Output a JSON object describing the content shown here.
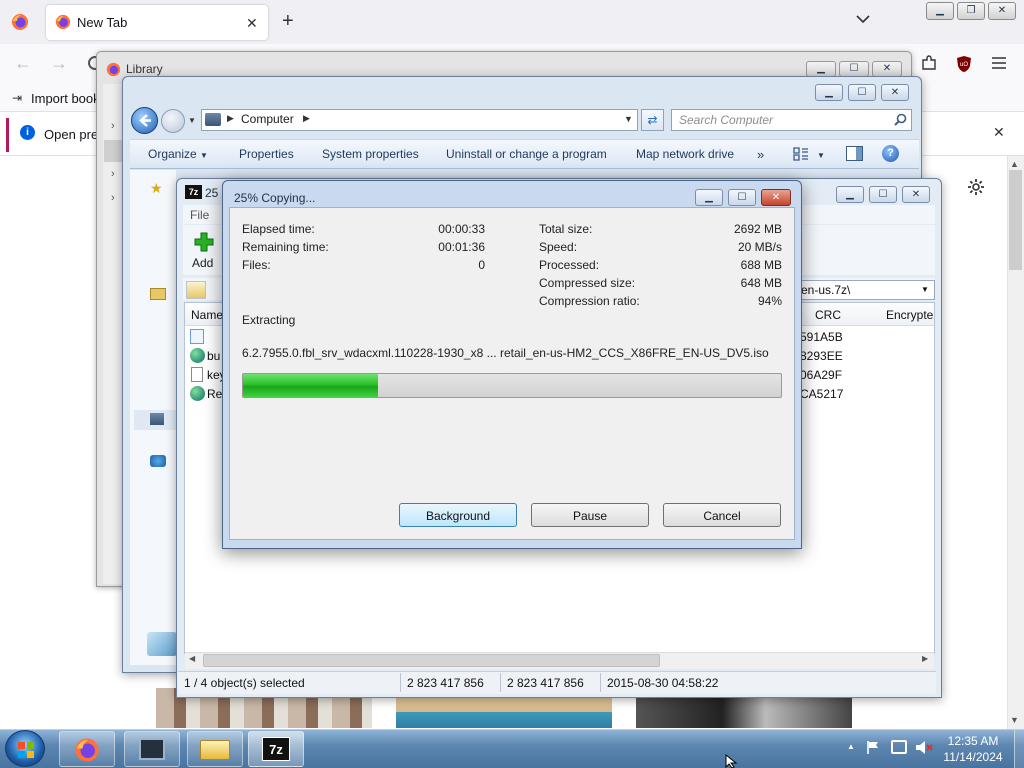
{
  "firefox": {
    "tab_title": "New Tab",
    "bookmark_label": "Import book",
    "notice_text": "Open prev"
  },
  "library": {
    "title": "Library"
  },
  "explorer": {
    "breadcrumb": "Computer",
    "search_placeholder": "Search Computer",
    "commands": [
      "Organize",
      "Properties",
      "System properties",
      "Uninstall or change a program",
      "Map network drive"
    ],
    "more_label": "»"
  },
  "sevenzip": {
    "title_partial": "25",
    "menu_file": "File",
    "add_label": "Add",
    "path_partial": "en-us.7z\\",
    "columns": {
      "name": "Name",
      "crc": "CRC",
      "encrypted": "Encrypte"
    },
    "rows": [
      {
        "name": "",
        "crc": "591A5B"
      },
      {
        "name": "bu",
        "crc": "8293EE"
      },
      {
        "name": "key",
        "crc": "06A29F"
      },
      {
        "name": "Re",
        "crc": "CA5217"
      }
    ],
    "status": {
      "selected": "1 / 4 object(s) selected",
      "size": "2 823 417 856",
      "packed": "2 823 417 856",
      "modified": "2015-08-30 04:58:22"
    }
  },
  "dialog": {
    "title": "25% Copying...",
    "elapsed_label": "Elapsed time:",
    "elapsed": "00:00:33",
    "remaining_label": "Remaining time:",
    "remaining": "00:01:36",
    "files_label": "Files:",
    "files": "0",
    "total_label": "Total size:",
    "total": "2692 MB",
    "speed_label": "Speed:",
    "speed": "20 MB/s",
    "processed_label": "Processed:",
    "processed": "688 MB",
    "compressed_label": "Compressed size:",
    "compressed": "648 MB",
    "ratio_label": "Compression ratio:",
    "ratio": "94%",
    "status": "Extracting",
    "filename": "6.2.7955.0.fbl_srv_wdacxml.110228-1930_x8 ... retail_en-us-HM2_CCS_X86FRE_EN-US_DV5.iso",
    "progress_percent": 25,
    "buttons": {
      "background": "Background",
      "pause": "Pause",
      "cancel": "Cancel"
    }
  },
  "taskbar": {
    "clock_time": "12:35 AM",
    "clock_date": "11/14/2024",
    "sevenzip_label": "7z"
  },
  "colors": {
    "progress_green": "#2cc12c",
    "firefox_accent": "#b21b5b",
    "taskbar": "#5d86b0"
  }
}
